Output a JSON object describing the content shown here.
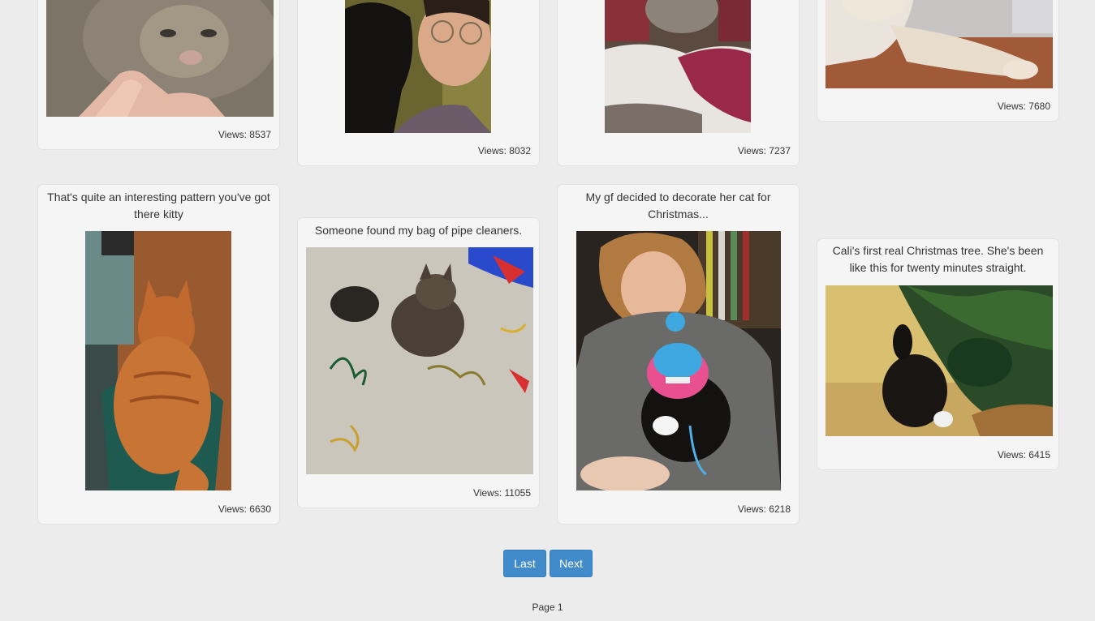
{
  "gallery": {
    "cards": [
      {
        "title": "",
        "views": "Views: 8537",
        "photo": "cat-hand-photo"
      },
      {
        "title": "",
        "views": "Views: 8032",
        "photo": "woman-black-kitten-photo"
      },
      {
        "title": "",
        "views": "Views: 7237",
        "photo": "tabby-blanket-photo"
      },
      {
        "title": "",
        "views": "Views: 7680",
        "photo": "cream-cat-floor-photo"
      },
      {
        "title": "That's quite an interesting pattern you've got there kitty",
        "views": "Views: 6630",
        "photo": "orange-cat-chair-photo"
      },
      {
        "title": "Someone found my bag of pipe cleaners.",
        "views": "Views: 11055",
        "photo": "tabby-pipe-cleaners-photo"
      },
      {
        "title": "My gf decided to decorate her cat for Christmas...",
        "views": "Views: 6218",
        "photo": "woman-cat-knit-hat-photo"
      },
      {
        "title": "Cali's first real Christmas tree. She's been like this for twenty minutes straight.",
        "views": "Views: 6415",
        "photo": "cat-christmas-tree-photo"
      }
    ]
  },
  "pagination": {
    "last_label": "Last",
    "next_label": "Next",
    "page_label": "Page 1"
  },
  "colors": {
    "background": "#ececec",
    "card": "#f5f5f5",
    "button": "#428bca"
  }
}
